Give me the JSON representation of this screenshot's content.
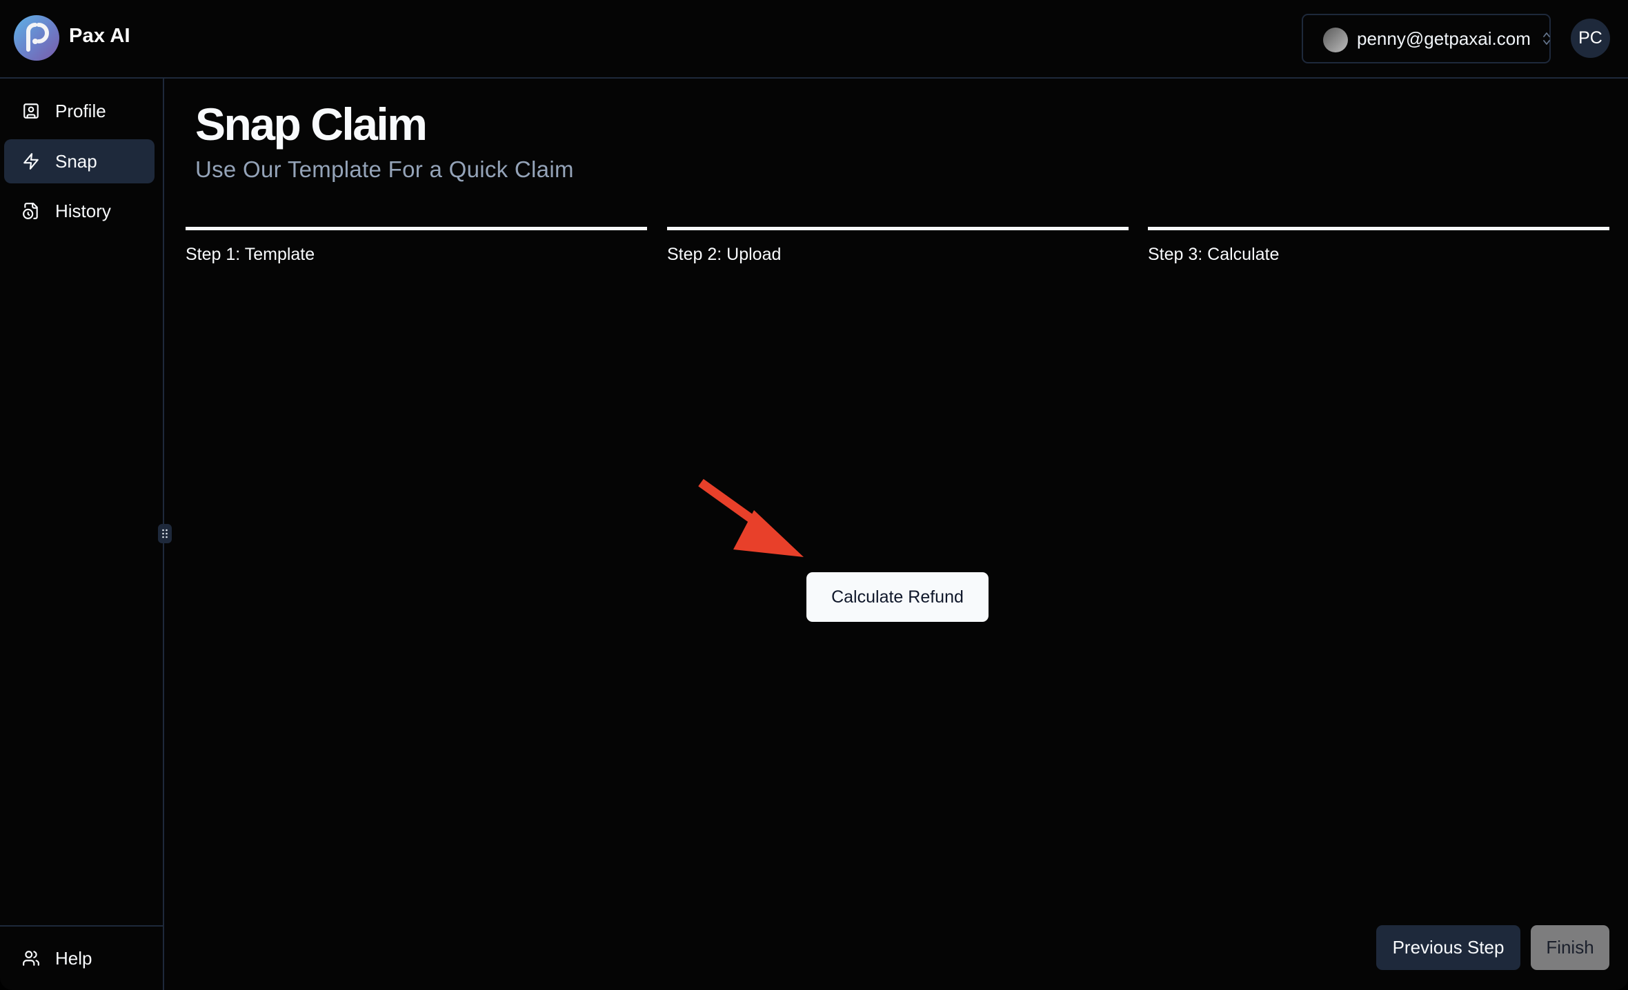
{
  "app": {
    "brand": "Pax AI",
    "logo_icon": "pax-logo-icon"
  },
  "header": {
    "account_email": "penny@getpaxai.com",
    "account_selector_icon": "chevrons-up-down-icon",
    "user_initials": "PC"
  },
  "sidebar": {
    "items": [
      {
        "label": "Profile",
        "icon": "user-square-icon",
        "active": false
      },
      {
        "label": "Snap",
        "icon": "zap-icon",
        "active": true
      },
      {
        "label": "History",
        "icon": "file-clock-icon",
        "active": false
      }
    ],
    "footer": {
      "label": "Help",
      "icon": "users-icon"
    }
  },
  "page": {
    "title": "Snap Claim",
    "subtitle": "Use Our Template For a Quick Claim"
  },
  "steps": [
    {
      "label": "Step 1: Template",
      "completed": true
    },
    {
      "label": "Step 2: Upload",
      "completed": true
    },
    {
      "label": "Step 3: Calculate",
      "completed": true
    }
  ],
  "actions": {
    "calculate": "Calculate Refund",
    "previous": "Previous Step",
    "finish": "Finish",
    "finish_disabled": true
  },
  "annotation": {
    "arrow_color": "#e8402a",
    "target": "calculate-refund-button"
  },
  "colors": {
    "background": "#050505",
    "border": "#1e293b",
    "active_nav": "#1e293b",
    "subtitle": "#94a3b8",
    "finish_disabled": "#7d7d7e"
  }
}
